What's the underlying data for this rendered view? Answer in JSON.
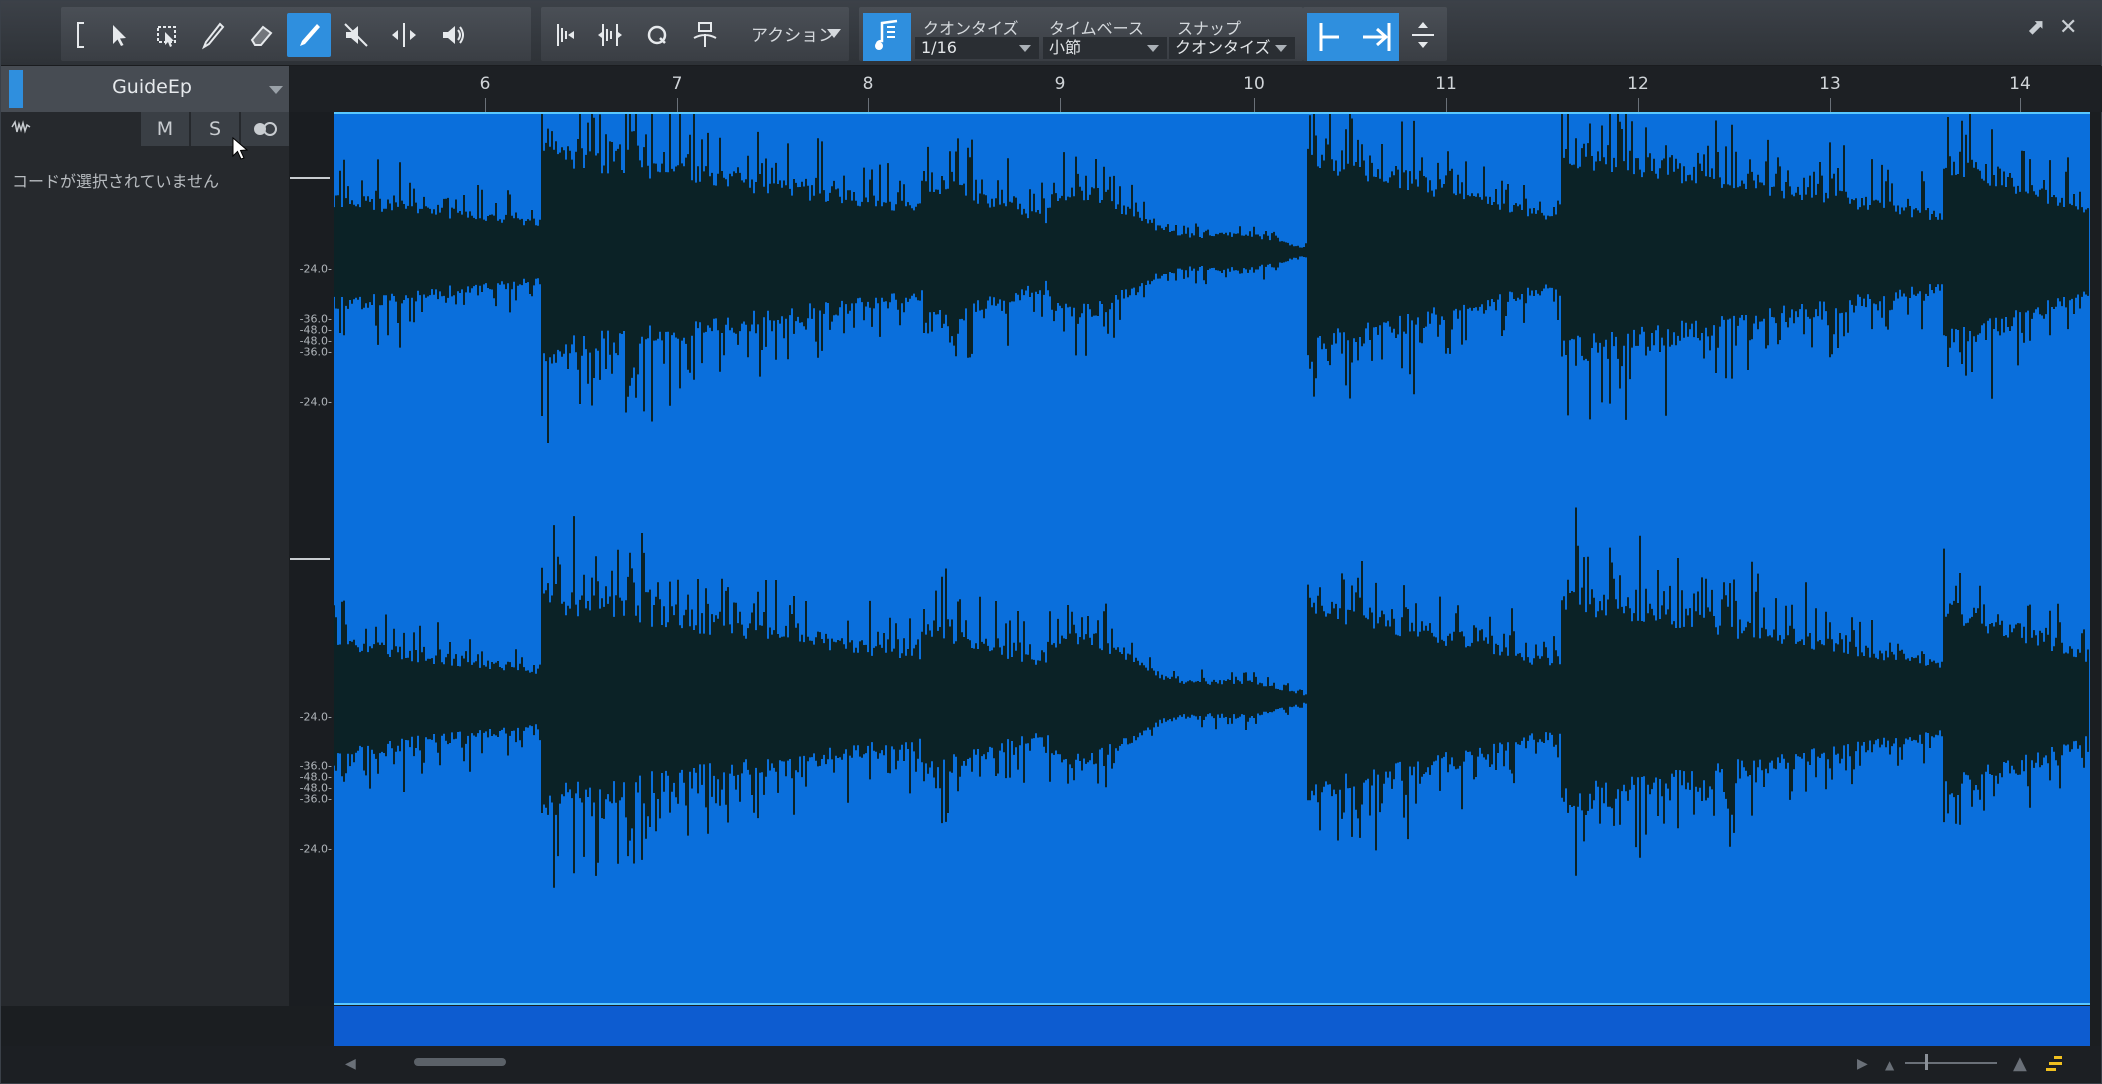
{
  "toolbar": {
    "tools": [
      {
        "name": "range-bracket-icon",
        "glyph": "["
      },
      {
        "name": "arrow-tool-icon",
        "glyph": "arrow"
      },
      {
        "name": "range-tool-icon",
        "glyph": "range"
      },
      {
        "name": "split-tool-icon",
        "glyph": "knife"
      },
      {
        "name": "eraser-tool-icon",
        "glyph": "eraser"
      },
      {
        "name": "paint-tool-icon",
        "glyph": "pencil",
        "active": true
      },
      {
        "name": "mute-tool-icon",
        "glyph": "mute"
      },
      {
        "name": "bend-tool-icon",
        "glyph": "bend"
      },
      {
        "name": "listen-tool-icon",
        "glyph": "speaker"
      }
    ],
    "action_label": "アクション",
    "quantize_label": "クオンタイズ",
    "quantize_value": "1/16",
    "timebase_label": "タイムベース",
    "timebase_value": "小節",
    "snap_label": "スナップ",
    "snap_value": "クオンタイズ"
  },
  "track": {
    "name": "GuideEp",
    "mute_label": "M",
    "solo_label": "S",
    "no_chord_text": "コードが選択されていません"
  },
  "ruler": {
    "bars": [
      "6",
      "7",
      "8",
      "9",
      "10",
      "11",
      "12",
      "13",
      "14"
    ]
  },
  "scale": {
    "channel1": [
      "-24.0-",
      "-36.0-",
      "-48.0-",
      "-48.0-",
      "-36.0-",
      "-24.0-"
    ],
    "channel2": [
      "-24.0-",
      "-36.0-",
      "-48.0-",
      "-48.0-",
      "-36.0-",
      "-24.0-"
    ]
  },
  "colors": {
    "accent": "#2f8fde",
    "wave_bg": "#0a6fdc",
    "waveform": "#0b2226"
  }
}
